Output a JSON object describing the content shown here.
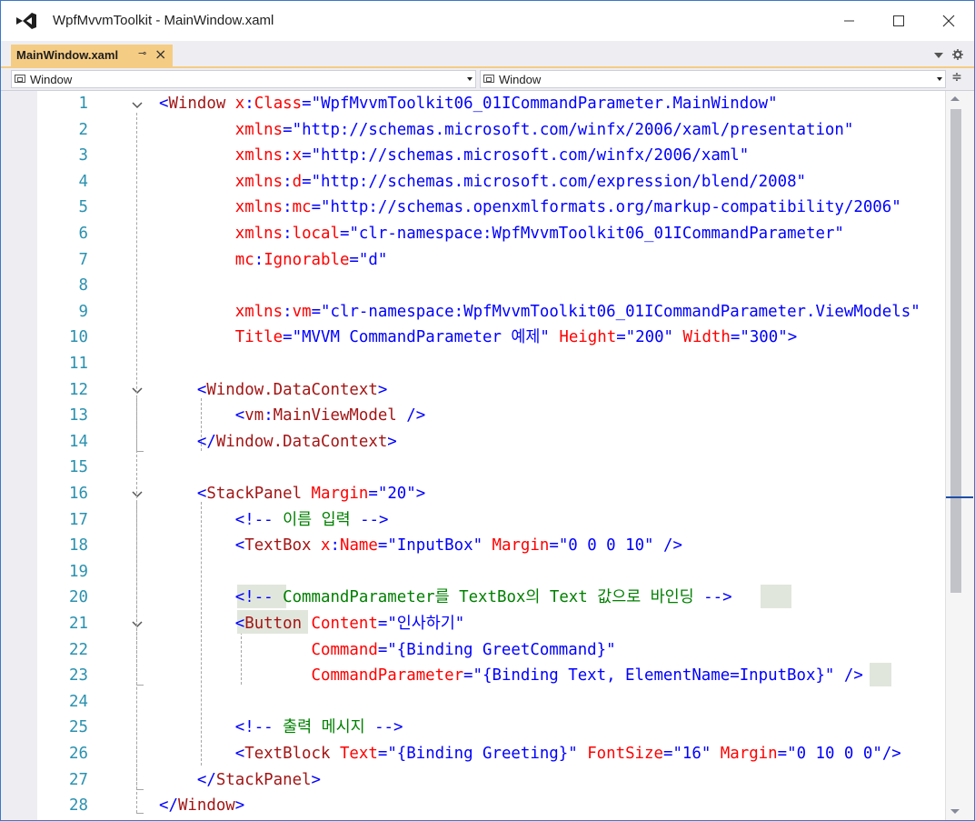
{
  "window": {
    "title": "WpfMvvmToolkit - MainWindow.xaml"
  },
  "tab": {
    "label": "MainWindow.xaml",
    "pin_glyph": "⊸",
    "close_glyph": "×"
  },
  "navbar": {
    "left_combo": "Window",
    "right_combo": "Window",
    "split_glyph": "≑"
  },
  "line_numbers": [
    "1",
    "2",
    "3",
    "4",
    "5",
    "6",
    "7",
    "8",
    "9",
    "10",
    "11",
    "12",
    "13",
    "14",
    "15",
    "16",
    "17",
    "18",
    "19",
    "20",
    "21",
    "22",
    "23",
    "24",
    "25",
    "26",
    "27",
    "28"
  ],
  "code": {
    "l1": [
      [
        "t-br",
        "<"
      ],
      [
        "t-tag",
        "Window"
      ],
      [
        "t-attr",
        " x"
      ],
      [
        "t-br",
        ":"
      ],
      [
        "t-attr",
        "Class"
      ],
      [
        "t-br",
        "="
      ],
      [
        "t-val",
        "\"WpfMvvmToolkit06_01ICommandParameter.MainWindow\""
      ]
    ],
    "l2": [
      [
        "t-attr",
        "        xmlns"
      ],
      [
        "t-br",
        "="
      ],
      [
        "t-val",
        "\"http://schemas.microsoft.com/winfx/2006/xaml/presentation\""
      ]
    ],
    "l3": [
      [
        "t-attr",
        "        xmlns"
      ],
      [
        "t-br",
        ":"
      ],
      [
        "t-attr",
        "x"
      ],
      [
        "t-br",
        "="
      ],
      [
        "t-val",
        "\"http://schemas.microsoft.com/winfx/2006/xaml\""
      ]
    ],
    "l4": [
      [
        "t-attr",
        "        xmlns"
      ],
      [
        "t-br",
        ":"
      ],
      [
        "t-attr",
        "d"
      ],
      [
        "t-br",
        "="
      ],
      [
        "t-val",
        "\"http://schemas.microsoft.com/expression/blend/2008\""
      ]
    ],
    "l5": [
      [
        "t-attr",
        "        xmlns"
      ],
      [
        "t-br",
        ":"
      ],
      [
        "t-attr",
        "mc"
      ],
      [
        "t-br",
        "="
      ],
      [
        "t-val",
        "\"http://schemas.openxmlformats.org/markup-compatibility/2006\""
      ]
    ],
    "l6": [
      [
        "t-attr",
        "        xmlns"
      ],
      [
        "t-br",
        ":"
      ],
      [
        "t-attr",
        "local"
      ],
      [
        "t-br",
        "="
      ],
      [
        "t-val",
        "\"clr-namespace:WpfMvvmToolkit06_01ICommandParameter\""
      ]
    ],
    "l7": [
      [
        "t-attr",
        "        mc"
      ],
      [
        "t-br",
        ":"
      ],
      [
        "t-attr",
        "Ignorable"
      ],
      [
        "t-br",
        "="
      ],
      [
        "t-val",
        "\"d\""
      ]
    ],
    "l8": [],
    "l9": [
      [
        "t-attr",
        "        xmlns"
      ],
      [
        "t-br",
        ":"
      ],
      [
        "t-attr",
        "vm"
      ],
      [
        "t-br",
        "="
      ],
      [
        "t-val",
        "\"clr-namespace:WpfMvvmToolkit06_01ICommandParameter.ViewModels\""
      ]
    ],
    "l10": [
      [
        "t-attr",
        "        Title"
      ],
      [
        "t-br",
        "="
      ],
      [
        "t-val",
        "\"MVVM CommandParameter 예제\""
      ],
      [
        "t-attr",
        " Height"
      ],
      [
        "t-br",
        "="
      ],
      [
        "t-val",
        "\"200\""
      ],
      [
        "t-attr",
        " Width"
      ],
      [
        "t-br",
        "="
      ],
      [
        "t-val",
        "\"300\""
      ],
      [
        "t-br",
        ">"
      ]
    ],
    "l11": [],
    "l12": [
      [
        "t-br",
        "    <"
      ],
      [
        "t-tag",
        "Window.DataContext"
      ],
      [
        "t-br",
        ">"
      ]
    ],
    "l13": [
      [
        "t-br",
        "        <"
      ],
      [
        "t-tag",
        "vm"
      ],
      [
        "t-br",
        ":"
      ],
      [
        "t-tag",
        "MainViewModel"
      ],
      [
        "t-br",
        " />"
      ]
    ],
    "l14": [
      [
        "t-br",
        "    </"
      ],
      [
        "t-tag",
        "Window.DataContext"
      ],
      [
        "t-br",
        ">"
      ]
    ],
    "l15": [],
    "l16": [
      [
        "t-br",
        "    <"
      ],
      [
        "t-tag",
        "StackPanel"
      ],
      [
        "t-attr",
        " Margin"
      ],
      [
        "t-br",
        "="
      ],
      [
        "t-val",
        "\"20\""
      ],
      [
        "t-br",
        ">"
      ]
    ],
    "l17": [
      [
        "t-br",
        "        <!--"
      ],
      [
        "t-com",
        " 이름 입력 "
      ],
      [
        "t-br",
        "-->"
      ]
    ],
    "l18": [
      [
        "t-br",
        "        <"
      ],
      [
        "t-tag",
        "TextBox"
      ],
      [
        "t-attr",
        " x"
      ],
      [
        "t-br",
        ":"
      ],
      [
        "t-attr",
        "Name"
      ],
      [
        "t-br",
        "="
      ],
      [
        "t-val",
        "\"InputBox\""
      ],
      [
        "t-attr",
        " Margin"
      ],
      [
        "t-br",
        "="
      ],
      [
        "t-val",
        "\"0 0 0 10\""
      ],
      [
        "t-br",
        " />"
      ]
    ],
    "l19": [],
    "l20": [
      [
        "t-br",
        "        <!--"
      ],
      [
        "t-com",
        " CommandParameter를 TextBox의 Text 값으로 바인딩 "
      ],
      [
        "t-br",
        "-->"
      ]
    ],
    "l21": [
      [
        "t-br",
        "        <"
      ],
      [
        "t-tag",
        "Button"
      ],
      [
        "t-attr",
        " Content"
      ],
      [
        "t-br",
        "="
      ],
      [
        "t-val",
        "\"인사하기\""
      ]
    ],
    "l22": [
      [
        "t-attr",
        "                Command"
      ],
      [
        "t-br",
        "="
      ],
      [
        "t-val",
        "\"{Binding GreetCommand}\""
      ]
    ],
    "l23": [
      [
        "t-attr",
        "                CommandParameter"
      ],
      [
        "t-br",
        "="
      ],
      [
        "t-val",
        "\"{Binding Text, ElementName=InputBox}\""
      ],
      [
        "t-br",
        " />"
      ]
    ],
    "l24": [],
    "l25": [
      [
        "t-br",
        "        <!--"
      ],
      [
        "t-com",
        " 출력 메시지 "
      ],
      [
        "t-br",
        "-->"
      ]
    ],
    "l26": [
      [
        "t-br",
        "        <"
      ],
      [
        "t-tag",
        "TextBlock"
      ],
      [
        "t-attr",
        " Text"
      ],
      [
        "t-br",
        "="
      ],
      [
        "t-val",
        "\"{Binding Greeting}\""
      ],
      [
        "t-attr",
        " FontSize"
      ],
      [
        "t-br",
        "="
      ],
      [
        "t-val",
        "\"16\""
      ],
      [
        "t-attr",
        " Margin"
      ],
      [
        "t-br",
        "="
      ],
      [
        "t-val",
        "\"0 10 0 0\""
      ],
      [
        "t-br",
        "/>"
      ]
    ],
    "l27": [
      [
        "t-br",
        "    </"
      ],
      [
        "t-tag",
        "StackPanel"
      ],
      [
        "t-br",
        ">"
      ]
    ],
    "l28": [
      [
        "t-br",
        "</"
      ],
      [
        "t-tag",
        "Window"
      ],
      [
        "t-br",
        ">"
      ]
    ]
  },
  "colors": {
    "tag": "#a31515",
    "attribute": "#ff0000",
    "punctuation_and_value": "#0000ff",
    "comment": "#008000",
    "line_number": "#2b91af",
    "active_tab": "#f5cc84",
    "window_border": "#3c78c8"
  },
  "icons": {
    "app_logo": "visual-studio-logo-icon",
    "minimize": "minimize-icon",
    "maximize": "maximize-icon",
    "close": "close-icon",
    "dropdown": "chevron-down-icon",
    "settings": "gear-icon",
    "fold": "chevron-down-icon"
  }
}
